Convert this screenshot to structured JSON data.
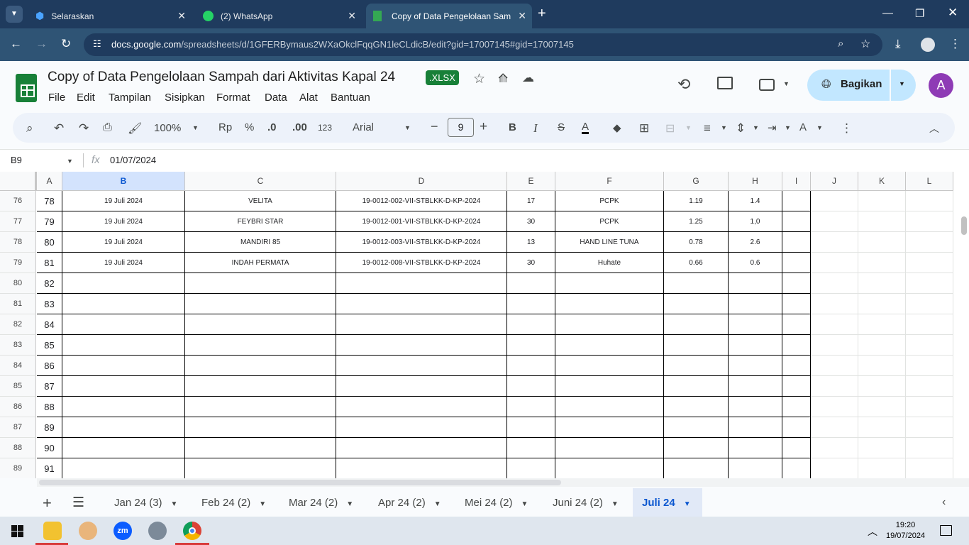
{
  "browser": {
    "tabs": [
      {
        "title": "Selaraskan",
        "close": "✕"
      },
      {
        "title": "(2) WhatsApp",
        "close": "✕"
      },
      {
        "title": "Copy of Data Pengelolaan Samp",
        "close": "✕"
      }
    ],
    "url_domain": "docs.google.com",
    "url_path": "/spreadsheets/d/1GFERBymaus2WXaOkclFqqGN1leCLdicB/edit?gid=17007145#gid=17007145"
  },
  "doc": {
    "title": "Copy of Data Pengelolaan Sampah dari Aktivitas Kapal 24",
    "badge": ".XLSX",
    "menu": [
      "File",
      "Edit",
      "Tampilan",
      "Sisipkan",
      "Format",
      "Data",
      "Alat",
      "Bantuan"
    ],
    "share_label": "Bagikan",
    "avatar_initial": "A"
  },
  "toolbar": {
    "zoom": "100%",
    "currency": "Rp",
    "percent": "%",
    "dec_decrease": ".0",
    "dec_increase": ".00",
    "number_format": "123",
    "font": "Arial",
    "font_size": "9"
  },
  "formula_bar": {
    "cell_ref": "B9",
    "fx": "fx",
    "value": "01/07/2024"
  },
  "grid": {
    "columns": [
      "A",
      "B",
      "C",
      "D",
      "E",
      "F",
      "G",
      "H",
      "I",
      "J",
      "K",
      "L"
    ],
    "selected_column": "B",
    "row_numbers": [
      "76",
      "77",
      "78",
      "79",
      "80",
      "81",
      "82",
      "83",
      "84",
      "85",
      "86",
      "87",
      "88",
      "89"
    ],
    "rows": [
      [
        "78",
        "19 Juli 2024",
        "VELITA",
        "19-0012-002-VII-STBLKK-D-KP-2024",
        "17",
        "PCPK",
        "1.19",
        "1.4"
      ],
      [
        "79",
        "19 Juli 2024",
        "FEYBRI STAR",
        "19-0012-001-VII-STBLKK-D-KP-2024",
        "30",
        "PCPK",
        "1.25",
        "1,0"
      ],
      [
        "80",
        "19 Juli 2024",
        "MANDIRI 85",
        "19-0012-003-VII-STBLKK-D-KP-2024",
        "13",
        "HAND LINE TUNA",
        "0.78",
        "2.6"
      ],
      [
        "81",
        "19 Juli 2024",
        "INDAH PERMATA",
        "19-0012-008-VII-STBLKK-D-KP-2024",
        "30",
        "Huhate",
        "0.66",
        "0.6"
      ],
      [
        "82",
        "",
        "",
        "",
        "",
        "",
        "",
        ""
      ],
      [
        "83",
        "",
        "",
        "",
        "",
        "",
        "",
        ""
      ],
      [
        "84",
        "",
        "",
        "",
        "",
        "",
        "",
        ""
      ],
      [
        "85",
        "",
        "",
        "",
        "",
        "",
        "",
        ""
      ],
      [
        "86",
        "",
        "",
        "",
        "",
        "",
        "",
        ""
      ],
      [
        "87",
        "",
        "",
        "",
        "",
        "",
        "",
        ""
      ],
      [
        "88",
        "",
        "",
        "",
        "",
        "",
        "",
        ""
      ],
      [
        "89",
        "",
        "",
        "",
        "",
        "",
        "",
        ""
      ],
      [
        "90",
        "",
        "",
        "",
        "",
        "",
        "",
        ""
      ],
      [
        "91",
        "",
        "",
        "",
        "",
        "",
        "",
        ""
      ]
    ]
  },
  "sheets": [
    "Jan 24 (3)",
    "Feb 24 (2)",
    "Mar 24 (2)",
    "Apr 24 (2)",
    "Mei 24 (2)",
    "Juni 24 (2)",
    "Juli 24"
  ],
  "active_sheet": "Juli 24",
  "taskbar": {
    "time": "19:20",
    "date": "19/07/2024",
    "zoom_app_label": "zm"
  }
}
